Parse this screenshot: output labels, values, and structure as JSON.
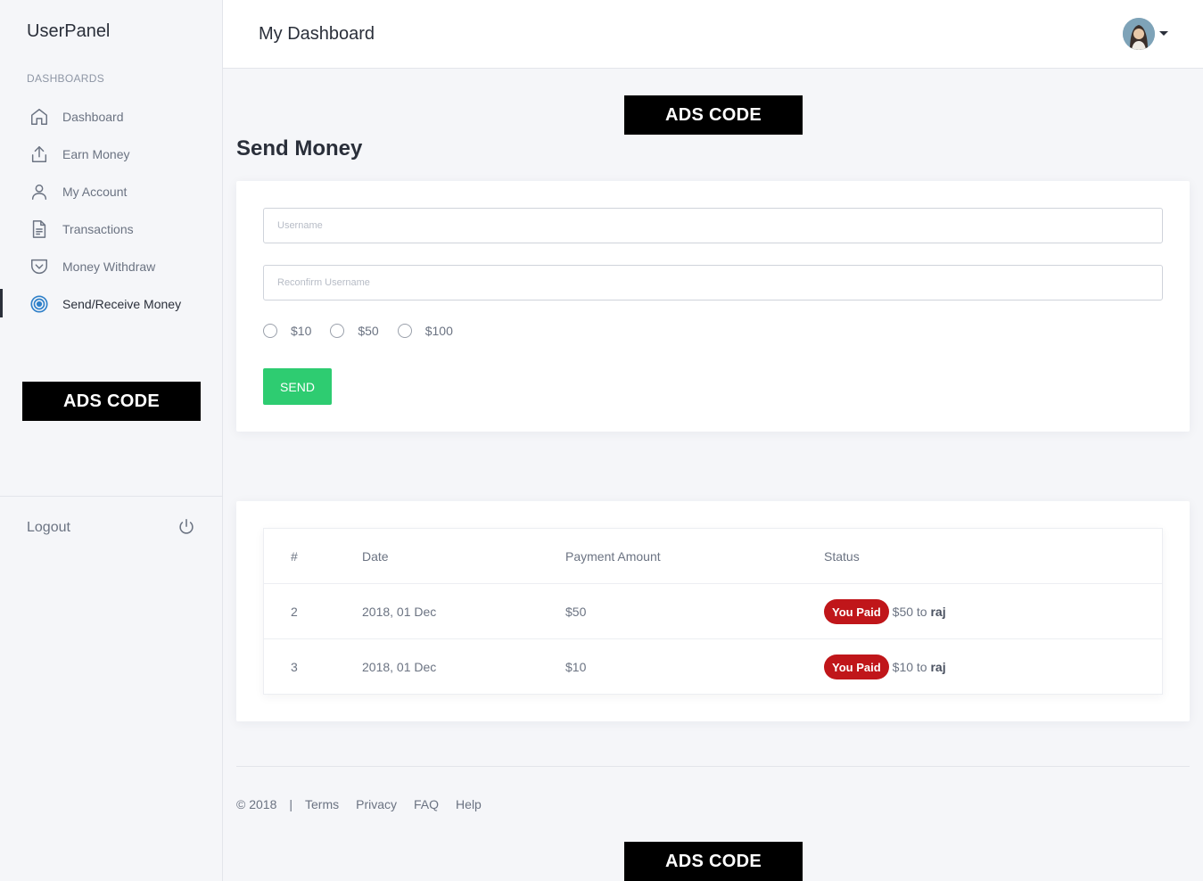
{
  "sidebar": {
    "brand": "UserPanel",
    "section_label": "DASHBOARDS",
    "items": [
      {
        "label": "Dashboard",
        "icon": "home-icon"
      },
      {
        "label": "Earn Money",
        "icon": "upload-icon"
      },
      {
        "label": "My Account",
        "icon": "user-icon"
      },
      {
        "label": "Transactions",
        "icon": "document-icon"
      },
      {
        "label": "Money Withdraw",
        "icon": "pocket-icon"
      },
      {
        "label": "Send/Receive Money",
        "icon": "target-icon",
        "active": true
      }
    ],
    "ads_label": "ADS CODE",
    "logout_label": "Logout"
  },
  "header": {
    "title": "My Dashboard"
  },
  "ads": {
    "top_label": "ADS CODE",
    "bottom_label": "ADS CODE"
  },
  "send_money": {
    "title": "Send Money",
    "username_placeholder": "Username",
    "reconfirm_placeholder": "Reconfirm Username",
    "amounts": [
      "$10",
      "$50",
      "$100"
    ],
    "send_label": "SEND"
  },
  "transactions": {
    "columns": [
      "#",
      "Date",
      "Payment Amount",
      "Status"
    ],
    "rows": [
      {
        "id": "2",
        "date": "2018, 01 Dec",
        "amount": "$50",
        "badge": "You Paid",
        "detail_amount": "$50",
        "detail_to": "to",
        "recipient": "raj"
      },
      {
        "id": "3",
        "date": "2018, 01 Dec",
        "amount": "$10",
        "badge": "You Paid",
        "detail_amount": "$10",
        "detail_to": "to",
        "recipient": "raj"
      }
    ]
  },
  "footer": {
    "copyright": "© 2018",
    "separator": "|",
    "links": [
      "Terms",
      "Privacy",
      "FAQ",
      "Help"
    ]
  },
  "colors": {
    "accent_green": "#2ecc71",
    "badge_red": "#c0161a",
    "active_icon_blue": "#2f80c9",
    "background": "#f5f6f9"
  }
}
